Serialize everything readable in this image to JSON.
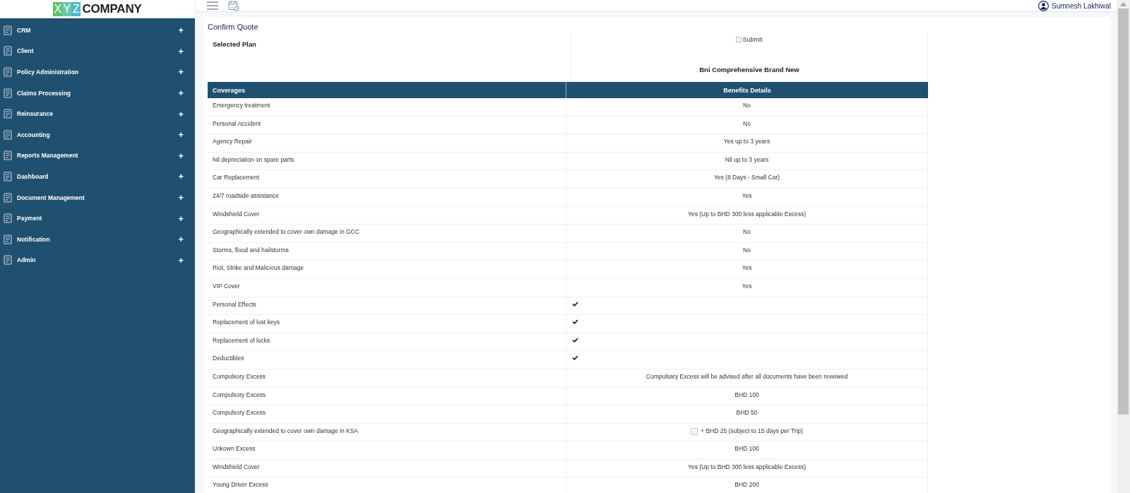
{
  "logo": {
    "mark": "XYZ",
    "name": "COMPANY"
  },
  "sidebar": {
    "items": [
      {
        "label": "CRM",
        "expander": "+"
      },
      {
        "label": "Client",
        "expander": "+"
      },
      {
        "label": "Policy Administration",
        "expander": "+"
      },
      {
        "label": "Claims Processing",
        "expander": "+"
      },
      {
        "label": "Reinsurance",
        "expander": "+"
      },
      {
        "label": "Accounting",
        "expander": "+"
      },
      {
        "label": "Reports Management",
        "expander": "+"
      },
      {
        "label": "Dashboard",
        "expander": "+"
      },
      {
        "label": "Document Management",
        "expander": "+"
      },
      {
        "label": "Payment",
        "expander": "+"
      },
      {
        "label": "Notification",
        "expander": "+"
      },
      {
        "label": "Admin",
        "expander": "+"
      }
    ]
  },
  "user": {
    "name": "Sumnesh Lakhiwal"
  },
  "page": {
    "title": "Confirm Quote",
    "plan_label": "Selected Plan",
    "image_alt": "Submit",
    "plan_name": "Bni Comprehensive Brand New"
  },
  "table": {
    "columns": [
      "Coverages",
      "Benefits Details"
    ],
    "rows": [
      {
        "kind": "text",
        "coverage": "Emergency treatment",
        "benefit": "No"
      },
      {
        "kind": "text",
        "coverage": "Personal Accident",
        "benefit": "No"
      },
      {
        "kind": "text",
        "coverage": "Agency Repair",
        "benefit": "Yes up to 3 years"
      },
      {
        "kind": "text",
        "coverage": "Nil depreciation on spare parts",
        "benefit": "Nil up to 3 years"
      },
      {
        "kind": "text",
        "coverage": "Car Replacement",
        "benefit": "Yes (8 Days - Small Car)"
      },
      {
        "kind": "text",
        "coverage": "24/7 roadside assistance",
        "benefit": "Yes"
      },
      {
        "kind": "text",
        "coverage": "Windshield Cover",
        "benefit": "Yes (Up to BHD 300 less applicable Excess)"
      },
      {
        "kind": "text",
        "coverage": "Geographically extended to cover own damage in GCC",
        "benefit": "No"
      },
      {
        "kind": "text",
        "coverage": "Storms, flood and hailstorms",
        "benefit": "No"
      },
      {
        "kind": "text",
        "coverage": "Riot, Strike and Malicious damage",
        "benefit": "Yes"
      },
      {
        "kind": "text",
        "coverage": "VIP Cover",
        "benefit": "Yes"
      },
      {
        "kind": "tick",
        "coverage": "Personal Effects"
      },
      {
        "kind": "tick",
        "coverage": "Replacement of lost keys"
      },
      {
        "kind": "tick",
        "coverage": "Replacement of locks"
      },
      {
        "kind": "tick",
        "coverage": "Deductibles"
      },
      {
        "kind": "text",
        "coverage": "Compulsory Excess",
        "benefit": "Compulsary Excess will be advised after all documents have been reveiwed"
      },
      {
        "kind": "text",
        "coverage": "Compulsory Excess",
        "benefit": "BHD 100"
      },
      {
        "kind": "text",
        "coverage": "Compulsory Excess",
        "benefit": "BHD 50"
      },
      {
        "kind": "checkbox",
        "coverage": "Geographically extended to cover own damage in KSA",
        "benefit": "+ BHD 25 (subject to 15 days per Trip)",
        "checked": false
      },
      {
        "kind": "text",
        "coverage": "Unkown Excess",
        "benefit": "BHD 100"
      },
      {
        "kind": "text",
        "coverage": "Windshield Cover",
        "benefit": "Yes (Up to BHD 300 less applicable Excess)"
      },
      {
        "kind": "text",
        "coverage": "Young Driver Excess",
        "benefit": "BHD 200"
      }
    ]
  }
}
